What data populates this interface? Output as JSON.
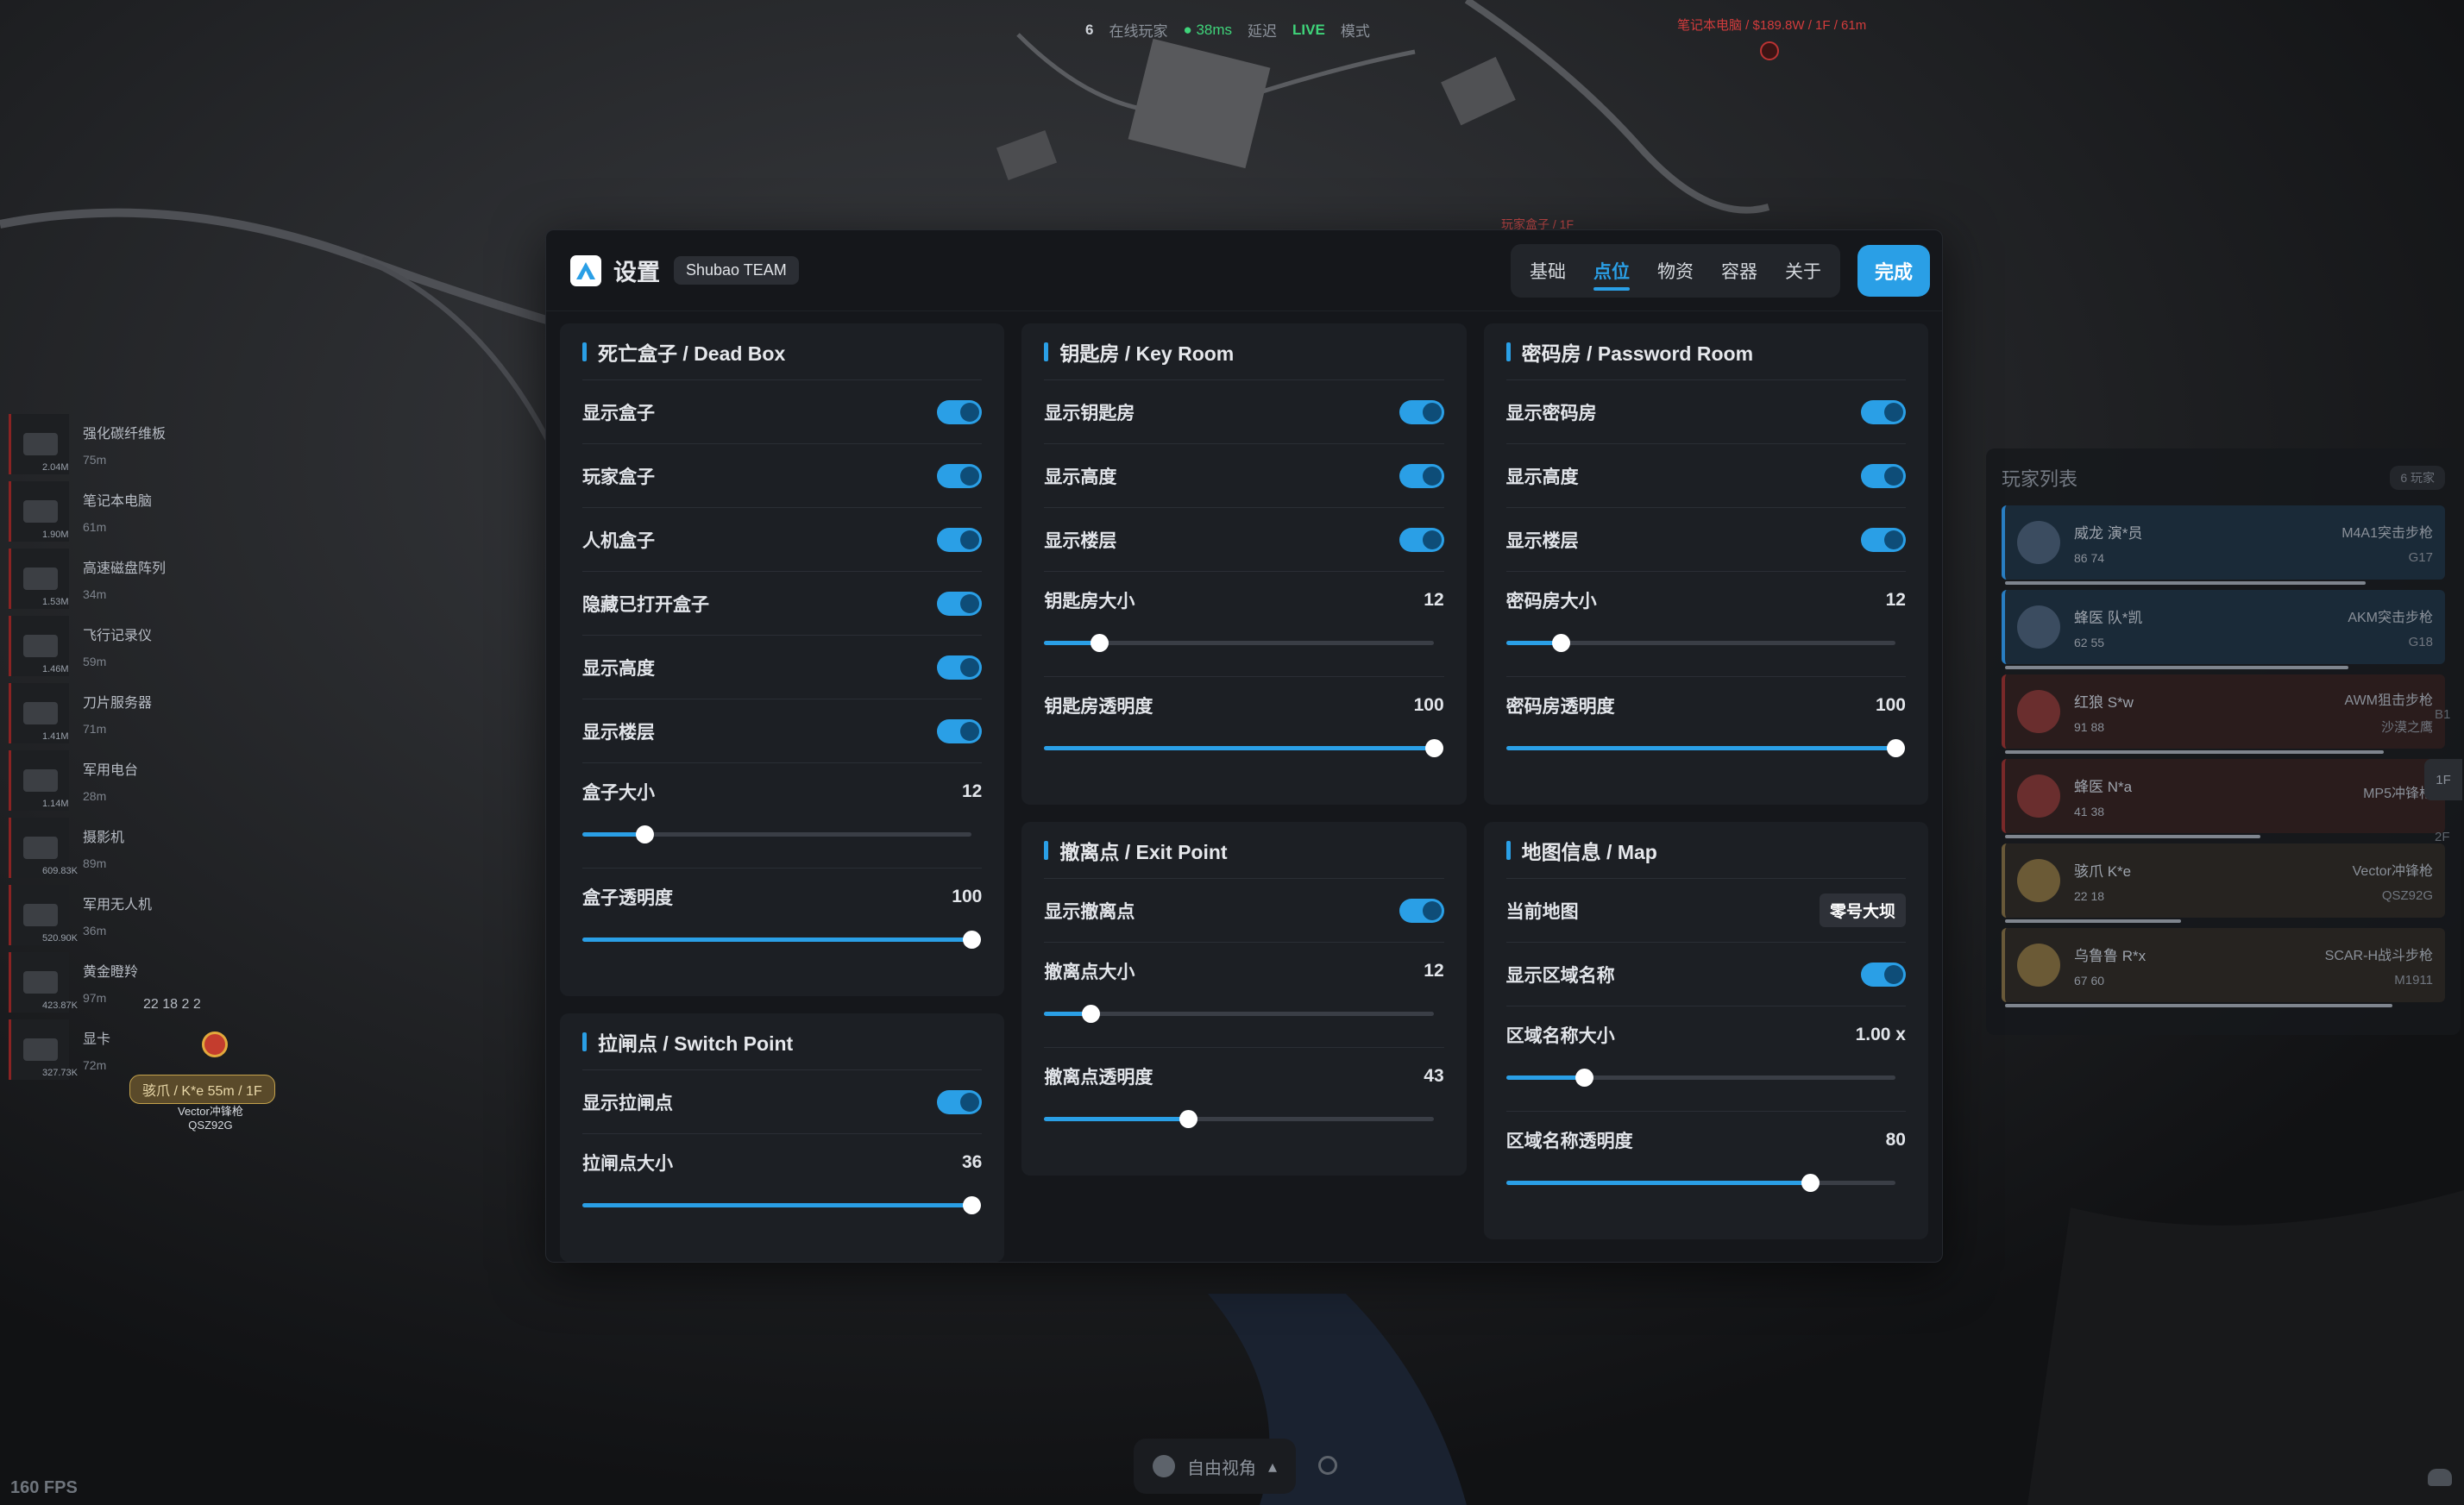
{
  "top": {
    "online_count": "6",
    "online_label": "在线玩家",
    "ping": "● 38ms",
    "latency_label": "延迟",
    "live": "LIVE",
    "mode_label": "模式"
  },
  "map_labels": {
    "target": "笔记本电脑 / $189.8W / 1F / 61m",
    "box": "玩家盒子 / 1F"
  },
  "loot": [
    {
      "name": "强化碳纤维板",
      "dist": "75m",
      "value": "2.04M"
    },
    {
      "name": "笔记本电脑",
      "dist": "61m",
      "value": "1.90M"
    },
    {
      "name": "高速磁盘阵列",
      "dist": "34m",
      "value": "1.53M"
    },
    {
      "name": "飞行记录仪",
      "dist": "59m",
      "value": "1.46M"
    },
    {
      "name": "刀片服务器",
      "dist": "71m",
      "value": "1.41M"
    },
    {
      "name": "军用电台",
      "dist": "28m",
      "value": "1.14M"
    },
    {
      "name": "摄影机",
      "dist": "89m",
      "value": "609.83K"
    },
    {
      "name": "军用无人机",
      "dist": "36m",
      "value": "520.90K"
    },
    {
      "name": "黄金瞪羚",
      "dist": "97m",
      "value": "423.87K"
    },
    {
      "name": "显卡",
      "dist": "72m",
      "value": "327.73K"
    }
  ],
  "map_player": {
    "counters": "22  18  2  2",
    "tag": "骇爪 / K*e 55m / 1F",
    "weapon": "Vector冲锋枪",
    "sidearm": "QSZ92G"
  },
  "fps": "160 FPS",
  "bottom": {
    "view_label": "自由视角",
    "caret": "▴"
  },
  "players": {
    "title": "玩家列表",
    "count": "6 玩家",
    "rows": [
      {
        "name": "威龙  演*员",
        "stats": "86  74",
        "weapon": "M4A1突击步枪",
        "side": "G17",
        "style": "blue",
        "hp": 0.82
      },
      {
        "name": "蜂医  队*凯",
        "stats": "62  55",
        "weapon": "AKM突击步枪",
        "side": "G18",
        "style": "blue",
        "hp": 0.78
      },
      {
        "name": "红狼  S*w",
        "stats": "91  88",
        "weapon": "AWM狙击步枪",
        "side": "沙漠之鹰",
        "style": "red",
        "hp": 0.86
      },
      {
        "name": "蜂医  N*a",
        "stats": "41  38",
        "weapon": "MP5冲锋枪",
        "side": "",
        "style": "red",
        "hp": 0.58
      },
      {
        "name": "骇爪  K*e",
        "stats": "22  18",
        "weapon": "Vector冲锋枪",
        "side": "QSZ92G",
        "style": "tan",
        "hp": 0.4
      },
      {
        "name": "乌鲁鲁  R*x",
        "stats": "67  60",
        "weapon": "SCAR-H战斗步枪",
        "side": "M1911",
        "style": "tan",
        "hp": 0.88
      }
    ],
    "floors": {
      "b1": "B1",
      "f1": "1F",
      "f2": "2F"
    }
  },
  "settings": {
    "title": "设置",
    "team": "Shubao TEAM",
    "tabs": [
      "基础",
      "点位",
      "物资",
      "容器",
      "关于"
    ],
    "active_tab": 1,
    "done": "完成",
    "dead_box": {
      "title": "死亡盒子 / Dead Box",
      "toggles": [
        "显示盒子",
        "玩家盒子",
        "人机盒子",
        "隐藏已打开盒子",
        "显示高度",
        "显示楼层"
      ],
      "size_label": "盒子大小",
      "size_value": "12",
      "size_pct": 0.16,
      "opacity_label": "盒子透明度",
      "opacity_value": "100",
      "opacity_pct": 1.0
    },
    "switch_point": {
      "title": "拉闸点 / Switch Point",
      "toggles": [
        "显示拉闸点"
      ],
      "size_label": "拉闸点大小",
      "size_value": "36",
      "size_pct": 1.0
    },
    "key_room": {
      "title": "钥匙房 / Key Room",
      "toggles": [
        "显示钥匙房",
        "显示高度",
        "显示楼层"
      ],
      "size_label": "钥匙房大小",
      "size_value": "12",
      "size_pct": 0.14,
      "opacity_label": "钥匙房透明度",
      "opacity_value": "100",
      "opacity_pct": 1.0
    },
    "exit_point": {
      "title": "撤离点 / Exit Point",
      "toggles": [
        "显示撤离点"
      ],
      "size_label": "撤离点大小",
      "size_value": "12",
      "size_pct": 0.12,
      "opacity_label": "撤离点透明度",
      "opacity_value": "43",
      "opacity_pct": 0.37
    },
    "password_room": {
      "title": "密码房 / Password Room",
      "toggles": [
        "显示密码房",
        "显示高度",
        "显示楼层"
      ],
      "size_label": "密码房大小",
      "size_value": "12",
      "size_pct": 0.14,
      "opacity_label": "密码房透明度",
      "opacity_value": "100",
      "opacity_pct": 1.0
    },
    "map_info": {
      "title": "地图信息 / Map",
      "current_map_label": "当前地图",
      "current_map_value": "零号大坝",
      "toggles": [
        "显示区域名称"
      ],
      "size_label": "区域名称大小",
      "size_value": "1.00 x",
      "size_pct": 0.2,
      "opacity_label": "区域名称透明度",
      "opacity_value": "80",
      "opacity_pct": 0.78
    }
  },
  "colors": {
    "accent": "#2a9fe6",
    "panel": "#15171b",
    "card": "#1c1f24"
  }
}
